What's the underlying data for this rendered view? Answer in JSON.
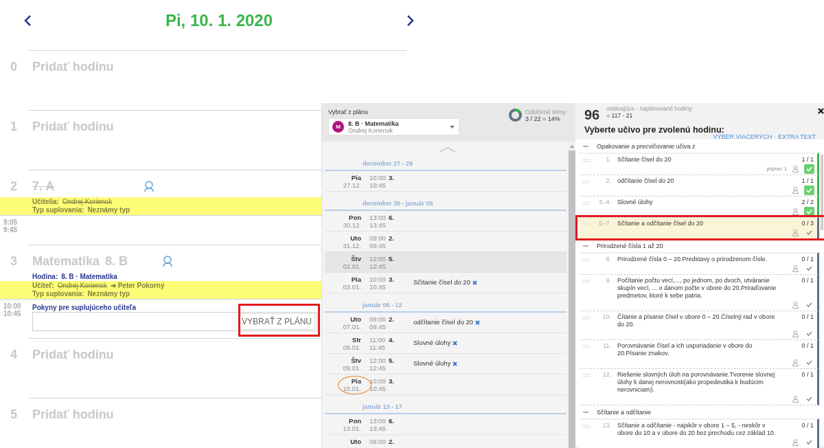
{
  "day": {
    "title": "Pi, 10. 1. 2020"
  },
  "slots": [
    {
      "kind": "empty",
      "number": "0",
      "label": "Pridať hodinu"
    },
    {
      "kind": "empty",
      "number": "1",
      "label": "Pridať hodinu"
    },
    {
      "kind": "lesson",
      "number": "2",
      "title": "7. A",
      "cancelled": true,
      "substitution": [
        {
          "label": "Učitelia:",
          "old": "Ondrej Korienok"
        },
        {
          "label": "Typ suplovania:",
          "value": "Neznámy typ"
        }
      ],
      "start": "9:05",
      "end": "9:45"
    },
    {
      "kind": "lesson",
      "number": "3",
      "title": "Matematika",
      "group": "8. B",
      "cancelled": false,
      "lesson_info": {
        "label": "Hodina:",
        "value": "8. B · Matematika"
      },
      "substitution": [
        {
          "label": "Učiteľ:",
          "old": "Ondrej Korienok",
          "value": "➔ Peter Pokorný"
        },
        {
          "label": "Typ suplovania:",
          "value": "Neznámy typ"
        }
      ],
      "start": "10:00",
      "end": "10:45",
      "instructions": {
        "label": "Pokyny pre suplujúceho učiteľa",
        "button": "VYBRAŤ Z PLÁNU",
        "highlighted": true
      }
    },
    {
      "kind": "empty",
      "number": "4",
      "label": "Pridať hodinu"
    },
    {
      "kind": "empty",
      "number": "5",
      "label": "Pridať hodinu"
    }
  ],
  "plan_panel": {
    "label": "Vybrať z plánu",
    "dropdown": {
      "avatar": "M",
      "title": "8. B · Matematika",
      "subtitle": "Ondrej Korienok"
    },
    "progress": {
      "label": "Odučené témy:",
      "value": "3 / 22 = 14%",
      "level": 0.14
    },
    "weeks": [
      {
        "title": "december 27 - 29",
        "rows": [
          {
            "day": "Pia",
            "date": "27.12.",
            "start": "10:00",
            "end": "10:45",
            "lesson": "3.",
            "selected": false,
            "circled": false
          }
        ]
      },
      {
        "title": "december 30 - január 05",
        "rows": [
          {
            "day": "Pon",
            "date": "30.12.",
            "start": "13:00",
            "end": "13:45",
            "lesson": "6.",
            "selected": false,
            "circled": false
          },
          {
            "day": "Uto",
            "date": "31.12.",
            "start": "09:00",
            "end": "09:45",
            "lesson": "2.",
            "selected": false,
            "circled": false
          },
          {
            "day": "Štv",
            "date": "02.01.",
            "start": "12:00",
            "end": "12:45",
            "lesson": "5.",
            "selected": true,
            "circled": false
          },
          {
            "day": "Pia",
            "date": "03.01.",
            "start": "10:00",
            "end": "10:45",
            "lesson": "3.",
            "topic": "Sčítanie čísel do 20",
            "selected": false,
            "circled": false
          }
        ]
      },
      {
        "title": "január 06 - 12",
        "rows": [
          {
            "day": "Uto",
            "date": "07.01.",
            "start": "09:00",
            "end": "09:45",
            "lesson": "2.",
            "topic": "odčítanie čísel do 20",
            "selected": false,
            "circled": false
          },
          {
            "day": "Str",
            "date": "08.01.",
            "start": "11:00",
            "end": "11:45",
            "lesson": "4.",
            "topic": "Slovné úlohy",
            "selected": false,
            "circled": false
          },
          {
            "day": "Štv",
            "date": "09.01.",
            "start": "12:00",
            "end": "12:45",
            "lesson": "5.",
            "topic": "Slovné úlohy",
            "selected": false,
            "circled": false
          },
          {
            "day": "Pia",
            "date": "10.01.",
            "start": "10:00",
            "end": "10:45",
            "lesson": "3.",
            "selected": false,
            "circled": true
          }
        ]
      },
      {
        "title": "január 13 - 17",
        "rows": [
          {
            "day": "Pon",
            "date": "13.01.",
            "start": "13:00",
            "end": "13:45",
            "lesson": "6.",
            "selected": false,
            "circled": false
          },
          {
            "day": "Uto",
            "date": "",
            "start": "09:00",
            "end": "",
            "lesson": "2.",
            "selected": false,
            "circled": false
          }
        ]
      }
    ]
  },
  "topics_panel": {
    "count": "96",
    "caption": "ostávajúce - naplánované hodiny:",
    "formula": "= 117 - 21",
    "heading": "Vyberte učivo pre zvolenú hodinu:",
    "links": [
      "VÝBER VIACERÝCH",
      "EXTRA TEXT"
    ],
    "link_separator": "·",
    "groups": [
      {
        "title": "Opakovanie a precvičovanie učiva z",
        "expanded": true,
        "items": [
          {
            "number": "1.",
            "text": "Sčítanie čísel do 20",
            "count": "1 / 1",
            "note": "príprav: 1",
            "done": true,
            "highlighted": false
          },
          {
            "number": "2.",
            "text": "odčítanie čísel do 20",
            "count": "1 / 1",
            "done": true,
            "highlighted": false
          },
          {
            "number": "3.-4.",
            "text": "Slovné úlohy",
            "count": "2 / 2",
            "done": true,
            "highlighted": false
          },
          {
            "number": "5.-7.",
            "text": "Sčítanie a odčítanie čísel do 20",
            "count": "0 / 3",
            "done": false,
            "highlighted": true
          }
        ]
      },
      {
        "title": "Prirodzené čísla 1 až 20",
        "expanded": true,
        "items": [
          {
            "number": "8.",
            "text": "Prirodzené čísla 0 – 20.Predstavy o prirodzenom čísle.",
            "count": "0 / 1",
            "done": false,
            "highlighted": false
          },
          {
            "number": "9.",
            "text": "Počítanie počtu vecí,..., po jednom, po dvoch, utváranie skupín vecí, ... o danom počte v obore do 20.Priraďovanie predmetov, ktoré k sebe patria.",
            "count": "0 / 1",
            "done": false,
            "highlighted": false
          },
          {
            "number": "10.",
            "text": "Čítanie a písanie čísel v obore 0 – 20.Číselný rad v obore do 20.",
            "count": "0 / 1",
            "done": false,
            "highlighted": false
          },
          {
            "number": "11.",
            "text": "Porovnávanie čísel a ich usporiadanie v obore do 20.Písanie znakov.",
            "count": "0 / 1",
            "done": false,
            "highlighted": false
          },
          {
            "number": "12.",
            "text": "Riešenie slovných úloh na porovnávanie.Tvorenie slovnej úlohy k danej nerovnosti(ako propedeutika k budúcim nerovniciam).",
            "count": "0 / 1",
            "done": false,
            "highlighted": false
          }
        ]
      },
      {
        "title": "Sčítanie a odčítanie",
        "expanded": true,
        "items": [
          {
            "number": "13.",
            "text": "Sčítanie a odčítanie - najskôr v obore 1 – 5, - neskôr v obore do 10 a v obore do 20 bez prechodu cez základ 10.",
            "count": "0 / 1",
            "done": false,
            "highlighted": false
          }
        ]
      }
    ]
  }
}
